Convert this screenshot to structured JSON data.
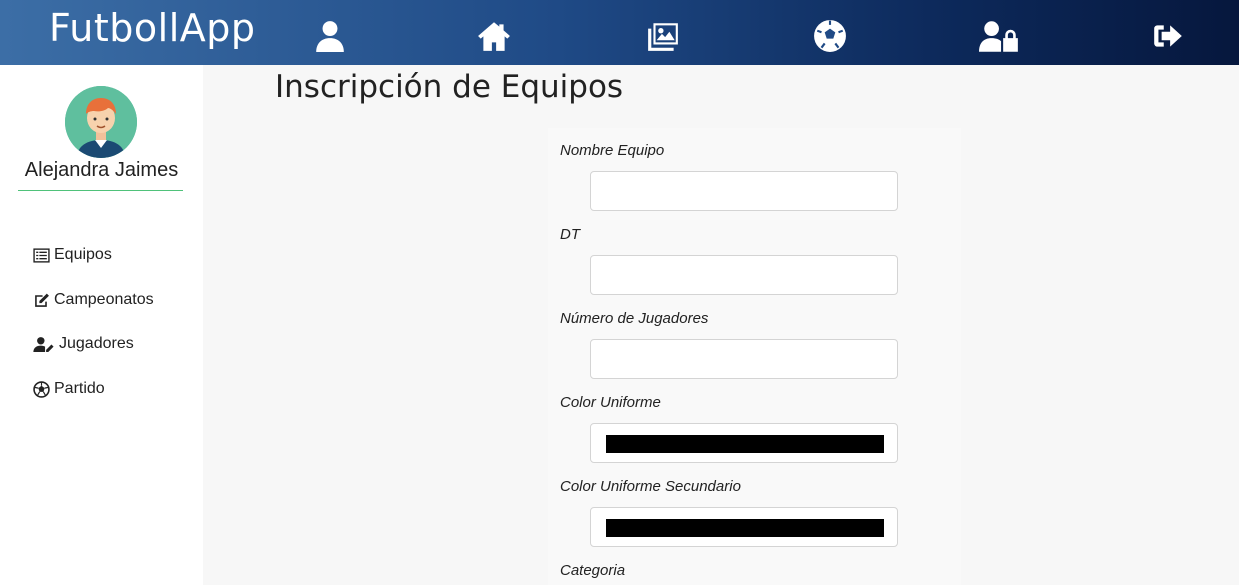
{
  "header": {
    "brand": "FutbollApp",
    "icons": [
      "user-icon",
      "home-icon",
      "gallery-icon",
      "soccer-ball-icon",
      "user-lock-icon",
      "sign-out-icon"
    ]
  },
  "sidebar": {
    "user_name": "Alejandra Jaimes",
    "items": [
      {
        "label": "Equipos",
        "icon": "list-icon"
      },
      {
        "label": "Campeonatos",
        "icon": "edit-icon"
      },
      {
        "label": "Jugadores",
        "icon": "user-edit-icon"
      },
      {
        "label": "Partido",
        "icon": "soccer-ball-icon"
      }
    ]
  },
  "main": {
    "title": "Inscripción de Equipos",
    "form": {
      "team_name_label": "Nombre Equipo",
      "team_name_value": "",
      "dt_label": "DT",
      "dt_value": "",
      "players_label": "Número de Jugadores",
      "players_value": "",
      "uniform_color_label": "Color Uniforme",
      "uniform_color_value": "#000000",
      "secondary_color_label": "Color Uniforme Secundario",
      "secondary_color_value": "#000000",
      "category_label": "Categoria"
    }
  },
  "colors": {
    "header_gradient_start": "#3c6ea6",
    "header_gradient_end": "#06173d",
    "divider": "#4fc27a",
    "avatar_bg": "#5fbf9e"
  }
}
